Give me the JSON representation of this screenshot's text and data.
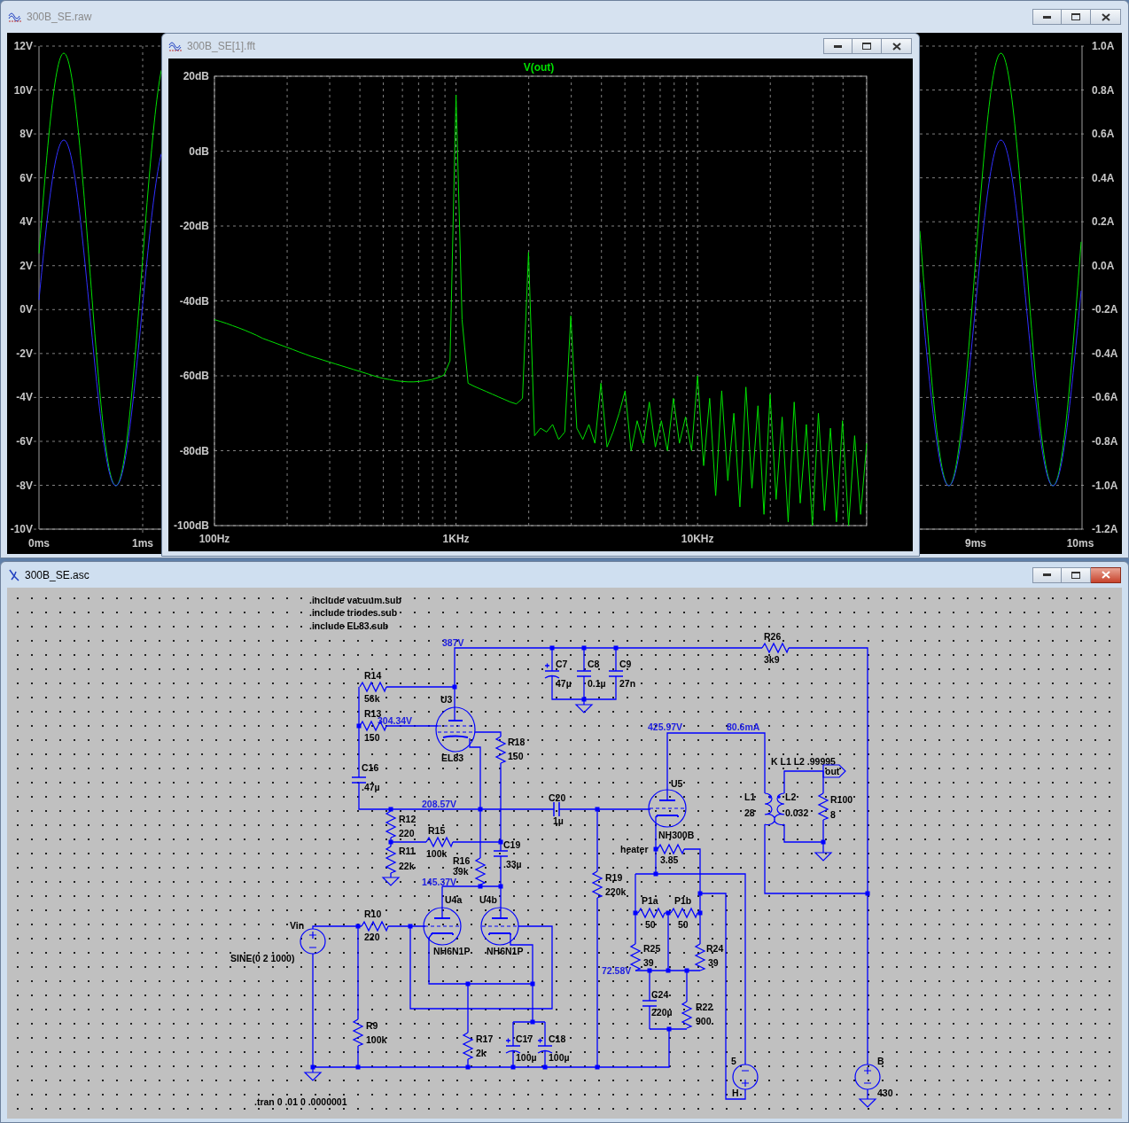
{
  "waveform_window": {
    "title": "300B_SE.raw",
    "active": false,
    "y_axis_left": [
      "12V",
      "10V",
      "8V",
      "6V",
      "4V",
      "2V",
      "0V",
      "-2V",
      "-4V",
      "-6V",
      "-8V",
      "-10V"
    ],
    "y_axis_right": [
      "1.0A",
      "0.8A",
      "0.6A",
      "0.4A",
      "0.2A",
      "0.0A",
      "-0.2A",
      "-0.4A",
      "-0.6A",
      "-0.8A",
      "-1.0A",
      "-1.2A"
    ],
    "x_axis": [
      "0ms",
      "1ms",
      "9ms",
      "10ms"
    ]
  },
  "fft_window": {
    "title": "300B_SE[1].fft",
    "active": false,
    "chart_data": {
      "type": "line",
      "grid": true,
      "ylim": [
        -100,
        20
      ],
      "categories": [
        "100Hz",
        null,
        null,
        null,
        null,
        null,
        null,
        null,
        null,
        null,
        null,
        null,
        null,
        null,
        null,
        null,
        null,
        null,
        null,
        null,
        null,
        null,
        null,
        null,
        null,
        null,
        null,
        null,
        null,
        null,
        null,
        null,
        null,
        null,
        null,
        null,
        null,
        null,
        null,
        null,
        "1KHz",
        null,
        null,
        null,
        null,
        null,
        null,
        null,
        null,
        null,
        null,
        null,
        null,
        null,
        null,
        null,
        null,
        null,
        null,
        null,
        null,
        null,
        null,
        null,
        null,
        null,
        null,
        null,
        null,
        null,
        null,
        null,
        null,
        null,
        null,
        null,
        null,
        null,
        null,
        null,
        "10KHz",
        null,
        null,
        null,
        null,
        null,
        null,
        null,
        null,
        null,
        null,
        null,
        null,
        null,
        null,
        null,
        null,
        null,
        null,
        null,
        null,
        null,
        null,
        null,
        null,
        null,
        null,
        null,
        null
      ],
      "yticks": [
        {
          "value": 20,
          "label": "20dB"
        },
        {
          "value": 0,
          "label": "0dB"
        },
        {
          "value": -20,
          "label": "-20dB"
        },
        {
          "value": -40,
          "label": "-40dB"
        },
        {
          "value": -60,
          "label": "-60dB"
        },
        {
          "value": -80,
          "label": "-80dB"
        },
        {
          "value": -100,
          "label": "-100dB"
        }
      ],
      "series": [
        {
          "name": "V(out)",
          "color": "#00e000",
          "values": [
            -45,
            -45.5,
            -46,
            -46.6,
            -47.2,
            -47.8,
            -48.5,
            -49.2,
            -50,
            -50.6,
            -51.2,
            -51.8,
            -52.4,
            -53,
            -53.6,
            -54.2,
            -54.8,
            -55.3,
            -55.8,
            -56.3,
            -56.8,
            -57.3,
            -57.8,
            -58.3,
            -58.8,
            -59.3,
            -59.8,
            -60.3,
            -60.7,
            -61,
            -61.3,
            -61.5,
            -61.6,
            -61.6,
            -61.5,
            -61.3,
            -61,
            -60.5,
            -59.8,
            -56,
            15,
            -45,
            -62,
            -62.8,
            -63.5,
            -64.2,
            -64.9,
            -65.6,
            -66.3,
            -67,
            -67.5,
            -66,
            -27,
            -76,
            -74,
            -75,
            -73,
            -77,
            -75,
            -44,
            -74,
            -77,
            -73,
            -78,
            -62,
            -79,
            -75,
            -70,
            -64,
            -80,
            -72,
            -78,
            -67,
            -79,
            -72,
            -80,
            -66,
            -78,
            -71,
            -80,
            -60,
            -84,
            -66,
            -92,
            -64,
            -88,
            -70,
            -95,
            -63,
            -90,
            -68,
            -97,
            -65,
            -93,
            -71,
            -99,
            -67,
            -94,
            -73,
            -100,
            -70,
            -96,
            -74,
            -99,
            -72,
            -100,
            -76,
            -97,
            -78
          ]
        }
      ]
    }
  },
  "schematic_window": {
    "title": "300B_SE.asc",
    "active": true,
    "directives": [
      ".include vacuum.sub",
      ".include triodes.sub",
      ".include EL83.sub"
    ],
    "node_labels": [
      "387V",
      "304.34V",
      "208.57V",
      "145.37V",
      "425.97V",
      "80.6mA",
      "72.58V"
    ],
    "components": [
      {
        "kind": "resistor",
        "name": "R26",
        "value": "3k9"
      },
      {
        "kind": "polarized_capacitor",
        "name": "C7",
        "value": "47µ"
      },
      {
        "kind": "capacitor",
        "name": "C8",
        "value": "0.1µ"
      },
      {
        "kind": "capacitor",
        "name": "C9",
        "value": "27n"
      },
      {
        "kind": "resistor",
        "name": "R14",
        "value": "56k"
      },
      {
        "kind": "resistor",
        "name": "R13",
        "value": "150"
      },
      {
        "kind": "pentode",
        "name": "U3",
        "value": "EL83"
      },
      {
        "kind": "resistor",
        "name": "R18",
        "value": "150"
      },
      {
        "kind": "capacitor",
        "name": "C16",
        "value": ".47µ"
      },
      {
        "kind": "capacitor",
        "name": "C20",
        "value": "1µ"
      },
      {
        "kind": "triode",
        "name": "U5",
        "value": "NH300B"
      },
      {
        "kind": "transformer",
        "name": "L1",
        "value": "28",
        "secondary_name": "L2",
        "secondary_value": "0.032",
        "coupling": "K L1 L2 .99995"
      },
      {
        "kind": "resistor",
        "name": "R100",
        "value": "8"
      },
      {
        "kind": "resistor",
        "name": "R12",
        "value": "220"
      },
      {
        "kind": "resistor",
        "name": "R15",
        "value": "100k"
      },
      {
        "kind": "resistor",
        "name": "R11",
        "value": "22k"
      },
      {
        "kind": "resistor",
        "name": "R16",
        "value": "39k"
      },
      {
        "kind": "capacitor",
        "name": "C19",
        "value": ".33µ"
      },
      {
        "kind": "resistor",
        "name": "R19",
        "value": "220k"
      },
      {
        "kind": "resistor",
        "name": "heater",
        "value": "3.85"
      },
      {
        "kind": "voltage_source",
        "name": "Vin",
        "value": "SINE(0 2 1000)"
      },
      {
        "kind": "resistor",
        "name": "R10",
        "value": "220"
      },
      {
        "kind": "triode",
        "name": "U4a",
        "value": "NH6N1P"
      },
      {
        "kind": "triode",
        "name": "U4b",
        "value": "NH6N1P"
      },
      {
        "kind": "resistor",
        "name": "P1a",
        "value": "50"
      },
      {
        "kind": "resistor",
        "name": "P1b",
        "value": "50"
      },
      {
        "kind": "resistor",
        "name": "R25",
        "value": "39"
      },
      {
        "kind": "resistor",
        "name": "R24",
        "value": "39"
      },
      {
        "kind": "capacitor",
        "name": "C24",
        "value": "220µ"
      },
      {
        "kind": "resistor",
        "name": "R22",
        "value": "900"
      },
      {
        "kind": "resistor",
        "name": "R9",
        "value": "100k"
      },
      {
        "kind": "resistor",
        "name": "R17",
        "value": "2k"
      },
      {
        "kind": "polarized_capacitor",
        "name": "C17",
        "value": "100µ"
      },
      {
        "kind": "polarized_capacitor",
        "name": "C18",
        "value": "100µ"
      },
      {
        "kind": "voltage_source",
        "name": "H",
        "value": "5"
      },
      {
        "kind": "voltage_source",
        "name": "B",
        "value": "430"
      }
    ],
    "net_labels": [
      "out"
    ],
    "simulation_command": ".tran 0 .01 0 .0000001"
  }
}
